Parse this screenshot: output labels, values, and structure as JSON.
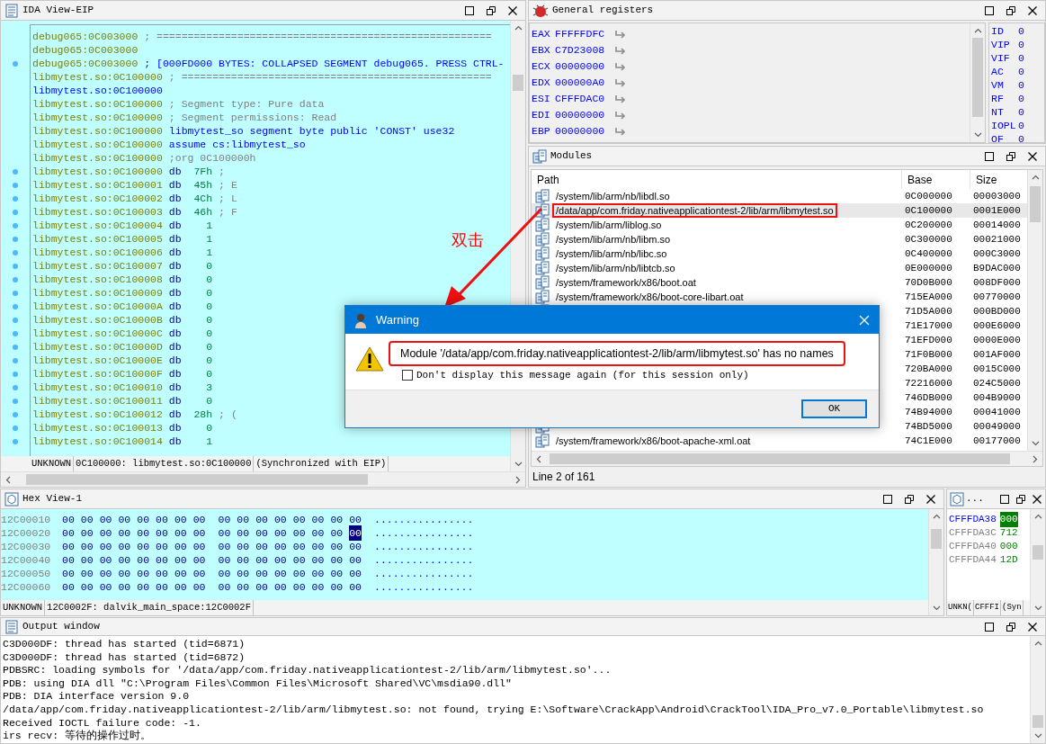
{
  "ida_view": {
    "title": "IDA View-EIP",
    "lines": [
      {
        "marker": false,
        "parts": [
          {
            "kind": "addr",
            "text": "debug065:0C003000"
          },
          {
            "kind": "comment",
            "text": " ; ======================================================"
          }
        ]
      },
      {
        "marker": false,
        "parts": [
          {
            "kind": "addr",
            "text": "debug065:0C003000"
          }
        ]
      },
      {
        "marker": true,
        "parts": [
          {
            "kind": "addr",
            "text": "debug065:0C003000"
          },
          {
            "kind": "code",
            "text": " ; [000FD000 BYTES: COLLAPSED SEGMENT debug065. PRESS CTRL-"
          }
        ]
      },
      {
        "marker": false,
        "parts": [
          {
            "kind": "addr",
            "text": "libmytest.so:0C100000"
          },
          {
            "kind": "comment",
            "text": " ; =================================================="
          }
        ]
      },
      {
        "marker": false,
        "parts": [
          {
            "kind": "label",
            "text": "libmytest.so:0C100000"
          }
        ]
      },
      {
        "marker": false,
        "parts": [
          {
            "kind": "addr",
            "text": "libmytest.so:0C100000"
          },
          {
            "kind": "comment",
            "text": " ; Segment type: Pure data"
          }
        ]
      },
      {
        "marker": false,
        "parts": [
          {
            "kind": "addr",
            "text": "libmytest.so:0C100000"
          },
          {
            "kind": "comment",
            "text": " ; Segment permissions: Read"
          }
        ]
      },
      {
        "marker": false,
        "parts": [
          {
            "kind": "addr",
            "text": "libmytest.so:0C100000"
          },
          {
            "kind": "code",
            "text": " libmytest_so segment byte public 'CONST' use32"
          }
        ]
      },
      {
        "marker": false,
        "parts": [
          {
            "kind": "addr",
            "text": "libmytest.so:0C100000"
          },
          {
            "kind": "code",
            "text": " assume cs:libmytest_so"
          }
        ]
      },
      {
        "marker": false,
        "parts": [
          {
            "kind": "addr",
            "text": "libmytest.so:0C100000"
          },
          {
            "kind": "comment",
            "text": " ;org 0C100000h"
          }
        ]
      },
      {
        "marker": true,
        "parts": [
          {
            "kind": "addr",
            "text": "libmytest.so:0C100000"
          },
          {
            "kind": "kw",
            "text": " db"
          },
          {
            "kind": "num",
            "text": "  7Fh"
          },
          {
            "kind": "comment",
            "text": " ;"
          }
        ]
      },
      {
        "marker": true,
        "parts": [
          {
            "kind": "addr",
            "text": "libmytest.so:0C100001"
          },
          {
            "kind": "kw",
            "text": " db"
          },
          {
            "kind": "num",
            "text": "  45h"
          },
          {
            "kind": "comment",
            "text": " ; E"
          }
        ]
      },
      {
        "marker": true,
        "parts": [
          {
            "kind": "addr",
            "text": "libmytest.so:0C100002"
          },
          {
            "kind": "kw",
            "text": " db"
          },
          {
            "kind": "num",
            "text": "  4Ch"
          },
          {
            "kind": "comment",
            "text": " ; L"
          }
        ]
      },
      {
        "marker": true,
        "parts": [
          {
            "kind": "addr",
            "text": "libmytest.so:0C100003"
          },
          {
            "kind": "kw",
            "text": " db"
          },
          {
            "kind": "num",
            "text": "  46h"
          },
          {
            "kind": "comment",
            "text": " ; F"
          }
        ]
      },
      {
        "marker": true,
        "parts": [
          {
            "kind": "addr",
            "text": "libmytest.so:0C100004"
          },
          {
            "kind": "kw",
            "text": " db"
          },
          {
            "kind": "num",
            "text": "    1"
          }
        ]
      },
      {
        "marker": true,
        "parts": [
          {
            "kind": "addr",
            "text": "libmytest.so:0C100005"
          },
          {
            "kind": "kw",
            "text": " db"
          },
          {
            "kind": "num",
            "text": "    1"
          }
        ]
      },
      {
        "marker": true,
        "parts": [
          {
            "kind": "addr",
            "text": "libmytest.so:0C100006"
          },
          {
            "kind": "kw",
            "text": " db"
          },
          {
            "kind": "num",
            "text": "    1"
          }
        ]
      },
      {
        "marker": true,
        "parts": [
          {
            "kind": "addr",
            "text": "libmytest.so:0C100007"
          },
          {
            "kind": "kw",
            "text": " db"
          },
          {
            "kind": "num",
            "text": "    0"
          }
        ]
      },
      {
        "marker": true,
        "parts": [
          {
            "kind": "addr",
            "text": "libmytest.so:0C100008"
          },
          {
            "kind": "kw",
            "text": " db"
          },
          {
            "kind": "num",
            "text": "    0"
          }
        ]
      },
      {
        "marker": true,
        "parts": [
          {
            "kind": "addr",
            "text": "libmytest.so:0C100009"
          },
          {
            "kind": "kw",
            "text": " db"
          },
          {
            "kind": "num",
            "text": "    0"
          }
        ]
      },
      {
        "marker": true,
        "parts": [
          {
            "kind": "addr",
            "text": "libmytest.so:0C10000A"
          },
          {
            "kind": "kw",
            "text": " db"
          },
          {
            "kind": "num",
            "text": "    0"
          }
        ]
      },
      {
        "marker": true,
        "parts": [
          {
            "kind": "addr",
            "text": "libmytest.so:0C10000B"
          },
          {
            "kind": "kw",
            "text": " db"
          },
          {
            "kind": "num",
            "text": "    0"
          }
        ]
      },
      {
        "marker": true,
        "parts": [
          {
            "kind": "addr",
            "text": "libmytest.so:0C10000C"
          },
          {
            "kind": "kw",
            "text": " db"
          },
          {
            "kind": "num",
            "text": "    0"
          }
        ]
      },
      {
        "marker": true,
        "parts": [
          {
            "kind": "addr",
            "text": "libmytest.so:0C10000D"
          },
          {
            "kind": "kw",
            "text": " db"
          },
          {
            "kind": "num",
            "text": "    0"
          }
        ]
      },
      {
        "marker": true,
        "parts": [
          {
            "kind": "addr",
            "text": "libmytest.so:0C10000E"
          },
          {
            "kind": "kw",
            "text": " db"
          },
          {
            "kind": "num",
            "text": "    0"
          }
        ]
      },
      {
        "marker": true,
        "parts": [
          {
            "kind": "addr",
            "text": "libmytest.so:0C10000F"
          },
          {
            "kind": "kw",
            "text": " db"
          },
          {
            "kind": "num",
            "text": "    0"
          }
        ]
      },
      {
        "marker": true,
        "parts": [
          {
            "kind": "addr",
            "text": "libmytest.so:0C100010"
          },
          {
            "kind": "kw",
            "text": " db"
          },
          {
            "kind": "num",
            "text": "    3"
          }
        ]
      },
      {
        "marker": true,
        "parts": [
          {
            "kind": "addr",
            "text": "libmytest.so:0C100011"
          },
          {
            "kind": "kw",
            "text": " db"
          },
          {
            "kind": "num",
            "text": "    0"
          }
        ]
      },
      {
        "marker": true,
        "parts": [
          {
            "kind": "addr",
            "text": "libmytest.so:0C100012"
          },
          {
            "kind": "kw",
            "text": " db"
          },
          {
            "kind": "num",
            "text": "  28h"
          },
          {
            "kind": "comment",
            "text": " ; ("
          }
        ]
      },
      {
        "marker": true,
        "parts": [
          {
            "kind": "addr",
            "text": "libmytest.so:0C100013"
          },
          {
            "kind": "kw",
            "text": " db"
          },
          {
            "kind": "num",
            "text": "    0"
          }
        ]
      },
      {
        "marker": true,
        "parts": [
          {
            "kind": "addr",
            "text": "libmytest.so:0C100014"
          },
          {
            "kind": "kw",
            "text": " db"
          },
          {
            "kind": "num",
            "text": "    1"
          }
        ]
      }
    ],
    "status": [
      "UNKNOWN",
      "0C100000: libmytest.so:0C100000",
      "(Synchronized with EIP)"
    ]
  },
  "registers": {
    "title": "General registers",
    "rows": [
      {
        "name": "EAX",
        "value": "FFFFFDFC"
      },
      {
        "name": "EBX",
        "value": "C7D23008"
      },
      {
        "name": "ECX",
        "value": "00000000"
      },
      {
        "name": "EDX",
        "value": "000000A0"
      },
      {
        "name": "ESI",
        "value": "CFFFDAC0"
      },
      {
        "name": "EDI",
        "value": "00000000"
      },
      {
        "name": "EBP",
        "value": "00000000"
      }
    ],
    "flags": [
      {
        "name": "ID",
        "value": "0"
      },
      {
        "name": "VIP",
        "value": "0"
      },
      {
        "name": "VIF",
        "value": "0"
      },
      {
        "name": "AC",
        "value": "0"
      },
      {
        "name": "VM",
        "value": "0"
      },
      {
        "name": "RF",
        "value": "0"
      },
      {
        "name": "NT",
        "value": "0"
      },
      {
        "name": "IOPL",
        "value": "0"
      },
      {
        "name": "OF",
        "value": "0"
      }
    ]
  },
  "modules": {
    "title": "Modules",
    "columns": [
      "Path",
      "Base",
      "Size"
    ],
    "rows": [
      {
        "path": "/system/lib/arm/nb/libdl.so",
        "base": "0C000000",
        "size": "00003000",
        "selected": false,
        "highlighted": false
      },
      {
        "path": "/data/app/com.friday.nativeapplicationtest-2/lib/arm/libmytest.so",
        "base": "0C100000",
        "size": "0001E000",
        "selected": true,
        "highlighted": true
      },
      {
        "path": "/system/lib/arm/liblog.so",
        "base": "0C200000",
        "size": "00014000",
        "selected": false,
        "highlighted": false
      },
      {
        "path": "/system/lib/arm/nb/libm.so",
        "base": "0C300000",
        "size": "00021000",
        "selected": false,
        "highlighted": false
      },
      {
        "path": "/system/lib/arm/nb/libc.so",
        "base": "0C400000",
        "size": "000C3000",
        "selected": false,
        "highlighted": false
      },
      {
        "path": "/system/lib/arm/nb/libtcb.so",
        "base": "0E000000",
        "size": "B9DAC000",
        "selected": false,
        "highlighted": false
      },
      {
        "path": "/system/framework/x86/boot.oat",
        "base": "70D0B000",
        "size": "008DF000",
        "selected": false,
        "highlighted": false
      },
      {
        "path": "/system/framework/x86/boot-core-libart.oat",
        "base": "715EA000",
        "size": "00770000",
        "selected": false,
        "highlighted": false
      },
      {
        "base": "71D5A000",
        "size": "000BD000",
        "selected": false
      },
      {
        "base": "71E17000",
        "size": "000E6000",
        "selected": false
      },
      {
        "base": "71EFD000",
        "size": "0000E000",
        "selected": false
      },
      {
        "base": "71F0B000",
        "size": "001AF000",
        "selected": false
      },
      {
        "base": "720BA000",
        "size": "0015C000",
        "selected": false
      },
      {
        "base": "72216000",
        "size": "024C5000",
        "selected": false
      },
      {
        "base": "746DB000",
        "size": "004B9000",
        "selected": false
      },
      {
        "base": "74B94000",
        "size": "00041000",
        "selected": false
      },
      {
        "base": "74BD5000",
        "size": "00049000",
        "selected": false
      },
      {
        "path": "/system/framework/x86/boot-apache-xml.oat",
        "base": "74C1E000",
        "size": "00177000",
        "selected": false,
        "highlighted": false
      }
    ],
    "footer": "Line 2 of 161"
  },
  "hex_view": {
    "title": "Hex View-1",
    "rows": [
      {
        "address": "12C00010",
        "ascii": "................",
        "bytes": [
          {
            "text": "00",
            "selected": false
          },
          {
            "text": "00",
            "selected": false
          },
          {
            "text": "00",
            "selected": false
          },
          {
            "text": "00",
            "selected": false
          },
          {
            "text": "00",
            "selected": false
          },
          {
            "text": "00",
            "selected": false
          },
          {
            "text": "00",
            "selected": false
          },
          {
            "text": "00",
            "selected": false
          },
          {
            "text": "00",
            "selected": false
          },
          {
            "text": "00",
            "selected": false
          },
          {
            "text": "00",
            "selected": false
          },
          {
            "text": "00",
            "selected": false
          },
          {
            "text": "00",
            "selected": false
          },
          {
            "text": "00",
            "selected": false
          },
          {
            "text": "00",
            "selected": false
          },
          {
            "text": "00",
            "selected": false
          }
        ]
      },
      {
        "address": "12C00020",
        "ascii": "................",
        "bytes": [
          {
            "text": "00",
            "selected": false
          },
          {
            "text": "00",
            "selected": false
          },
          {
            "text": "00",
            "selected": false
          },
          {
            "text": "00",
            "selected": false
          },
          {
            "text": "00",
            "selected": false
          },
          {
            "text": "00",
            "selected": false
          },
          {
            "text": "00",
            "selected": false
          },
          {
            "text": "00",
            "selected": false
          },
          {
            "text": "00",
            "selected": false
          },
          {
            "text": "00",
            "selected": false
          },
          {
            "text": "00",
            "selected": false
          },
          {
            "text": "00",
            "selected": false
          },
          {
            "text": "00",
            "selected": false
          },
          {
            "text": "00",
            "selected": false
          },
          {
            "text": "00",
            "selected": false
          },
          {
            "text": "00",
            "selected": true
          }
        ]
      },
      {
        "address": "12C00030",
        "ascii": "................",
        "bytes": [
          {
            "text": "00",
            "selected": false
          },
          {
            "text": "00",
            "selected": false
          },
          {
            "text": "00",
            "selected": false
          },
          {
            "text": "00",
            "selected": false
          },
          {
            "text": "00",
            "selected": false
          },
          {
            "text": "00",
            "selected": false
          },
          {
            "text": "00",
            "selected": false
          },
          {
            "text": "00",
            "selected": false
          },
          {
            "text": "00",
            "selected": false
          },
          {
            "text": "00",
            "selected": false
          },
          {
            "text": "00",
            "selected": false
          },
          {
            "text": "00",
            "selected": false
          },
          {
            "text": "00",
            "selected": false
          },
          {
            "text": "00",
            "selected": false
          },
          {
            "text": "00",
            "selected": false
          },
          {
            "text": "00",
            "selected": false
          }
        ]
      },
      {
        "address": "12C00040",
        "ascii": "................",
        "bytes": [
          {
            "text": "00",
            "selected": false
          },
          {
            "text": "00",
            "selected": false
          },
          {
            "text": "00",
            "selected": false
          },
          {
            "text": "00",
            "selected": false
          },
          {
            "text": "00",
            "selected": false
          },
          {
            "text": "00",
            "selected": false
          },
          {
            "text": "00",
            "selected": false
          },
          {
            "text": "00",
            "selected": false
          },
          {
            "text": "00",
            "selected": false
          },
          {
            "text": "00",
            "selected": false
          },
          {
            "text": "00",
            "selected": false
          },
          {
            "text": "00",
            "selected": false
          },
          {
            "text": "00",
            "selected": false
          },
          {
            "text": "00",
            "selected": false
          },
          {
            "text": "00",
            "selected": false
          },
          {
            "text": "00",
            "selected": false
          }
        ]
      },
      {
        "address": "12C00050",
        "ascii": "................",
        "bytes": [
          {
            "text": "00",
            "selected": false
          },
          {
            "text": "00",
            "selected": false
          },
          {
            "text": "00",
            "selected": false
          },
          {
            "text": "00",
            "selected": false
          },
          {
            "text": "00",
            "selected": false
          },
          {
            "text": "00",
            "selected": false
          },
          {
            "text": "00",
            "selected": false
          },
          {
            "text": "00",
            "selected": false
          },
          {
            "text": "00",
            "selected": false
          },
          {
            "text": "00",
            "selected": false
          },
          {
            "text": "00",
            "selected": false
          },
          {
            "text": "00",
            "selected": false
          },
          {
            "text": "00",
            "selected": false
          },
          {
            "text": "00",
            "selected": false
          },
          {
            "text": "00",
            "selected": false
          },
          {
            "text": "00",
            "selected": false
          }
        ]
      },
      {
        "address": "12C00060",
        "ascii": "................",
        "bytes": [
          {
            "text": "00",
            "selected": false
          },
          {
            "text": "00",
            "selected": false
          },
          {
            "text": "00",
            "selected": false
          },
          {
            "text": "00",
            "selected": false
          },
          {
            "text": "00",
            "selected": false
          },
          {
            "text": "00",
            "selected": false
          },
          {
            "text": "00",
            "selected": false
          },
          {
            "text": "00",
            "selected": false
          },
          {
            "text": "00",
            "selected": false
          },
          {
            "text": "00",
            "selected": false
          },
          {
            "text": "00",
            "selected": false
          },
          {
            "text": "00",
            "selected": false
          },
          {
            "text": "00",
            "selected": false
          },
          {
            "text": "00",
            "selected": false
          },
          {
            "text": "00",
            "selected": false
          },
          {
            "text": "00",
            "selected": false
          }
        ]
      }
    ],
    "status": [
      "UNKNOWN",
      "12C0002F: dalvik_main_space:12C0002F"
    ]
  },
  "stack_view": {
    "title": "...",
    "rows": [
      {
        "address": "CFFFDA38",
        "value": "000",
        "selected": true
      },
      {
        "address": "CFFFDA3C",
        "value": "712",
        "selected": false
      },
      {
        "address": "CFFFDA40",
        "value": "000",
        "selected": false
      },
      {
        "address": "CFFFDA44",
        "value": "12D",
        "selected": false
      }
    ],
    "status": [
      "UNKN(",
      "CFFFI",
      "(Syn"
    ]
  },
  "output": {
    "title": "Output window",
    "lines": [
      "C3D000DF: thread has started (tid=6871)",
      "C3D000DF: thread has started (tid=6872)",
      "PDBSRC: loading symbols for '/data/app/com.friday.nativeapplicationtest-2/lib/arm/libmytest.so'...",
      "PDB: using DIA dll \"C:\\Program Files\\Common Files\\Microsoft Shared\\VC\\msdia90.dll\"",
      "PDB: DIA interface version 9.0",
      "/data/app/com.friday.nativeapplicationtest-2/lib/arm/libmytest.so: not found, trying E:\\Software\\CrackApp\\Android\\CrackTool\\IDA_Pro_v7.0_Portable\\libmytest.so",
      "Received IOCTL failure code: -1.",
      "irs recv: 等待的操作过时。"
    ]
  },
  "dialog": {
    "title": "Warning",
    "message": "Module '/data/app/com.friday.nativeapplicationtest-2/lib/arm/libmytest.so' has no names",
    "message_highlighted": true,
    "checkbox": {
      "label": "Don't display this message again (for this session only)",
      "checked": false
    },
    "buttons": [
      "OK"
    ]
  },
  "annotation": {
    "label": "双击"
  }
}
